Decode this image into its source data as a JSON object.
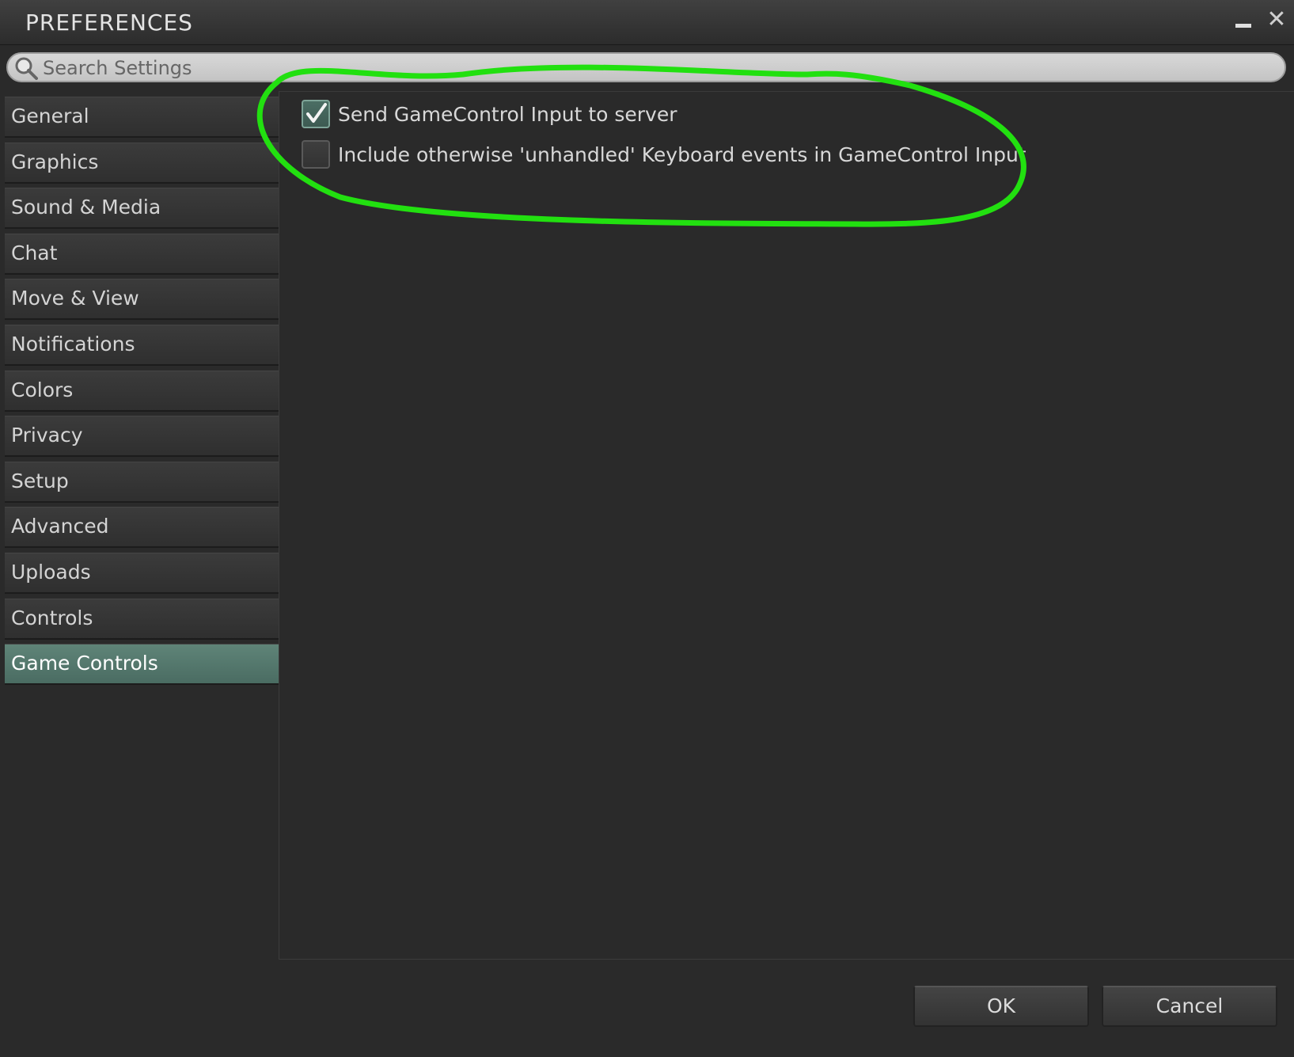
{
  "window": {
    "title": "PREFERENCES",
    "minimize_icon": "minimize-icon",
    "close_label": "✕"
  },
  "search": {
    "placeholder": "Search Settings",
    "value": ""
  },
  "sidebar": {
    "items": [
      {
        "label": "General"
      },
      {
        "label": "Graphics"
      },
      {
        "label": "Sound & Media"
      },
      {
        "label": "Chat"
      },
      {
        "label": "Move & View"
      },
      {
        "label": "Notifications"
      },
      {
        "label": "Colors"
      },
      {
        "label": "Privacy"
      },
      {
        "label": "Setup"
      },
      {
        "label": "Advanced"
      },
      {
        "label": "Uploads"
      },
      {
        "label": "Controls"
      },
      {
        "label": "Game Controls"
      }
    ],
    "selected": "Game Controls"
  },
  "panel": {
    "checkboxes": [
      {
        "label": "Send GameControl Input to server",
        "checked": true
      },
      {
        "label": "Include otherwise 'unhandled' Keyboard events in GameControl Input",
        "checked": false
      }
    ]
  },
  "footer": {
    "ok_label": "OK",
    "cancel_label": "Cancel"
  },
  "colors": {
    "accent": "#567b70",
    "annotation": "#22e010",
    "background": "#2a2a2a"
  }
}
